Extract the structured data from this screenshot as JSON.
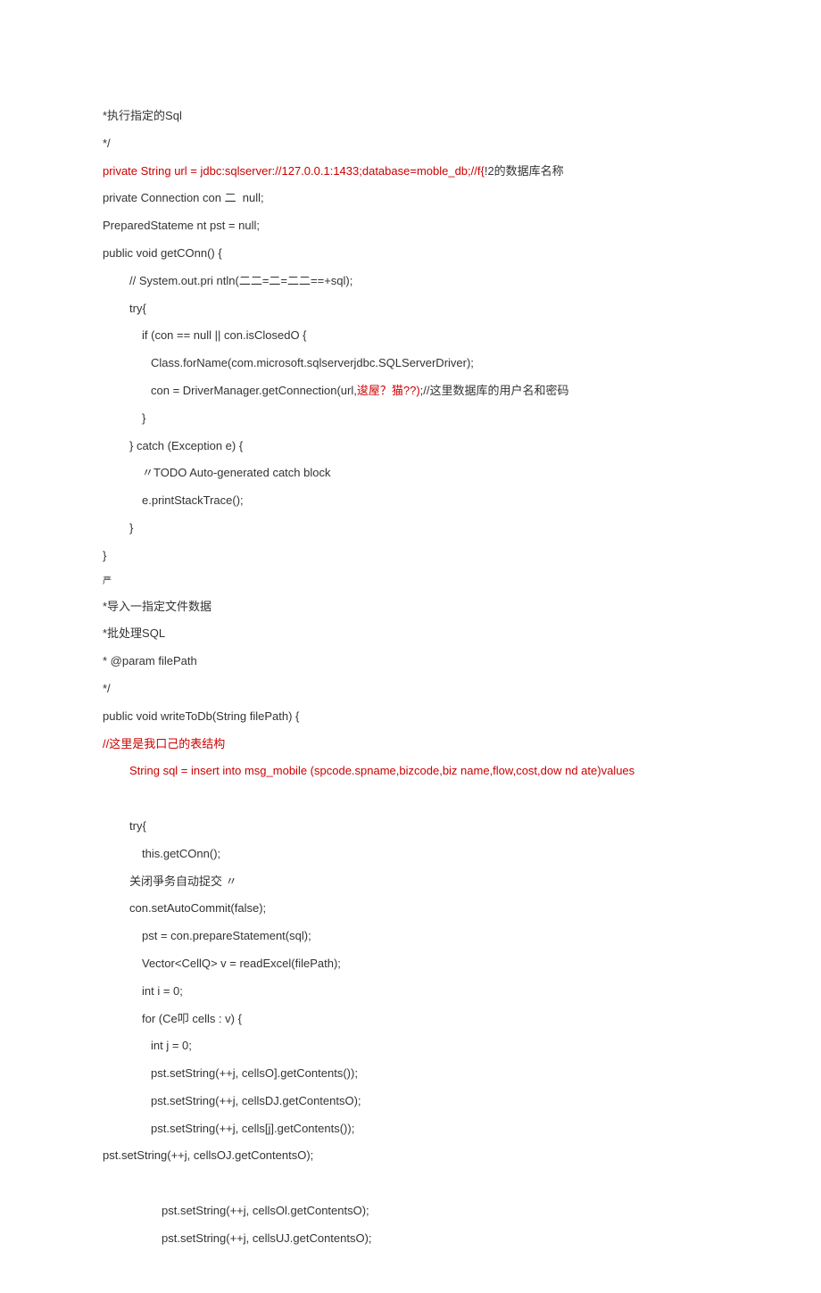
{
  "lines": [
    {
      "cls": "line",
      "text": "*执行指定的Sql"
    },
    {
      "cls": "line",
      "text": "*/"
    },
    {
      "cls": "line",
      "parts": [
        {
          "cls": "red",
          "text": "private String url = jdbc:sqlserver://127.0.0.1:1433;database=moble_db;//f{"
        },
        {
          "cls": "black",
          "text": "!2的数据库名称"
        }
      ]
    },
    {
      "cls": "line",
      "text": "private Connection con 二  null;"
    },
    {
      "cls": "line",
      "text": "PreparedStateme nt pst = null;"
    },
    {
      "cls": "line",
      "text": "public void getCOnn() {"
    },
    {
      "cls": "line ind1",
      "text": "// System.out.pri ntln(二二=二=二二==+sql);"
    },
    {
      "cls": "line ind1",
      "text": "try{"
    },
    {
      "cls": "line ind2",
      "text": "if (con == null || con.isClosedO {"
    },
    {
      "cls": "line ind3",
      "text": "Class.forName(com.microsoft.sqlserverjdbc.SQLServerDriver);"
    },
    {
      "cls": "line ind3",
      "parts": [
        {
          "cls": "black",
          "text": "con = DriverManager.getConnection(url,"
        },
        {
          "cls": "red",
          "text": "逡屋？猫??)"
        },
        {
          "cls": "black",
          "text": ";//这里数据库的用户名和密码"
        }
      ]
    },
    {
      "cls": "line ind2",
      "text": "}"
    },
    {
      "cls": "line ind1",
      "text": "} catch (Exception e) {"
    },
    {
      "cls": "line ind2",
      "text": "〃TODO Auto-generated catch block"
    },
    {
      "cls": "line ind2",
      "text": "e.printStackTrace();"
    },
    {
      "cls": "line ind1",
      "text": "}"
    },
    {
      "cls": "line",
      "text": "}"
    },
    {
      "cls": "line sm",
      "text": "严"
    },
    {
      "cls": "line",
      "text": "*导入一指定文件数据"
    },
    {
      "cls": "line",
      "text": "*批处理SQL"
    },
    {
      "cls": "line",
      "text": "* @param filePath"
    },
    {
      "cls": "line",
      "text": "*/"
    },
    {
      "cls": "line",
      "text": "public void writeToDb(String filePath) {"
    },
    {
      "cls": "line red",
      "text": "//这里是我口己的表结构"
    },
    {
      "cls": "line ind1 red",
      "text": "String sql = insert into msg_mobile (spcode.spname,bizcode,biz name,flow,cost,dow nd ate)values"
    },
    {
      "cls": "line",
      "text": " "
    },
    {
      "cls": "line ind1",
      "text": "try{"
    },
    {
      "cls": "line ind2",
      "text": "this.getCOnn();"
    },
    {
      "cls": "line ind1",
      "text": "关闭爭务自动捉交 〃"
    },
    {
      "cls": "line ind1",
      "text": "con.setAutoCommit(false);"
    },
    {
      "cls": "line ind2",
      "text": "pst = con.prepareStatement(sql);"
    },
    {
      "cls": "line ind2",
      "text": "Vector<CellQ> v = readExcel(filePath);"
    },
    {
      "cls": "line ind2",
      "text": "int i = 0;"
    },
    {
      "cls": "line ind2",
      "text": "for (Ce叩 cells : v) {"
    },
    {
      "cls": "line ind3",
      "text": "int j = 0;"
    },
    {
      "cls": "line ind3",
      "text": "pst.setString(++j, cellsO].getContents());"
    },
    {
      "cls": "line ind3",
      "text": "pst.setString(++j, cellsDJ.getContentsO);"
    },
    {
      "cls": "line ind3",
      "text": "pst.setString(++j, cells[j].getContents());"
    },
    {
      "cls": "line",
      "text": "pst.setString(++j, cellsOJ.getContentsO);"
    },
    {
      "cls": "line",
      "text": " "
    },
    {
      "cls": "line ind4",
      "text": "pst.setString(++j, cellsOl.getContentsO);"
    },
    {
      "cls": "line ind4",
      "text": "pst.setString(++j, cellsUJ.getContentsO);"
    }
  ]
}
